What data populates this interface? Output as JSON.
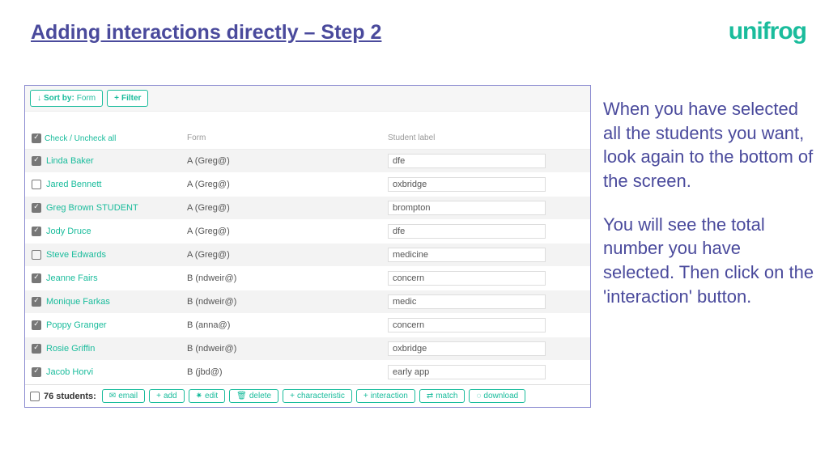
{
  "header": {
    "title": "Adding interactions directly – Step 2"
  },
  "brand": {
    "logo": "unifrog"
  },
  "toolbar": {
    "sort_label": "Sort by:",
    "sort_value": "Form",
    "filter_label": "Filter"
  },
  "columns": {
    "check_all": "Check / Uncheck all",
    "form": "Form",
    "label": "Student label"
  },
  "rows": [
    {
      "checked": true,
      "name": "Linda Baker",
      "form": "A (Greg@)",
      "label": "dfe"
    },
    {
      "checked": false,
      "name": "Jared Bennett",
      "form": "A (Greg@)",
      "label": "oxbridge"
    },
    {
      "checked": true,
      "name": "Greg Brown STUDENT",
      "form": "A (Greg@)",
      "label": "brompton"
    },
    {
      "checked": true,
      "name": "Jody Druce",
      "form": "A (Greg@)",
      "label": "dfe"
    },
    {
      "checked": false,
      "name": "Steve Edwards",
      "form": "A (Greg@)",
      "label": "medicine"
    },
    {
      "checked": true,
      "name": "Jeanne Fairs",
      "form": "B (ndweir@)",
      "label": "concern"
    },
    {
      "checked": true,
      "name": "Monique Farkas",
      "form": "B (ndweir@)",
      "label": "medic"
    },
    {
      "checked": true,
      "name": "Poppy Granger",
      "form": "B (anna@)",
      "label": "concern"
    },
    {
      "checked": true,
      "name": "Rosie Griffin",
      "form": "B (ndweir@)",
      "label": "oxbridge"
    },
    {
      "checked": true,
      "name": "Jacob Horvi",
      "form": "B (jbd@)",
      "label": "early app"
    }
  ],
  "footer": {
    "count_label": "76 students:",
    "buttons": {
      "email": "email",
      "add": "add",
      "edit": "edit",
      "delete": "delete",
      "characteristic": "characteristic",
      "interaction": "interaction",
      "match": "match",
      "download": "download"
    }
  },
  "side": {
    "p1": "When you have selected all the students you want, look again to the bottom of the screen.",
    "p2": "You will see the total number you have selected. Then click on the 'interaction' button."
  }
}
